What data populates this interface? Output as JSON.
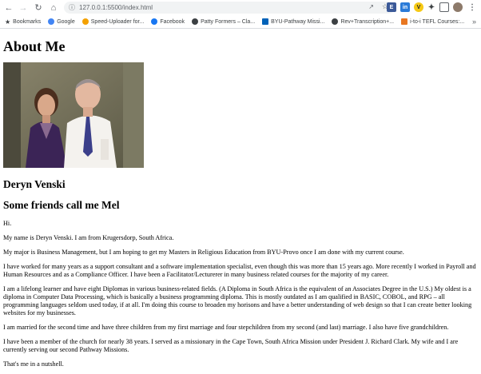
{
  "browser": {
    "url": "127.0.0.1:5500/index.html",
    "bookmarks": [
      {
        "label": "Bookmarks",
        "icon": "star-icon",
        "color": "#3c4043"
      },
      {
        "label": "Google",
        "icon": "google-icon",
        "color": "#4285f4"
      },
      {
        "label": "Speed-Uploader for...",
        "icon": "speed-uploader-icon",
        "color": "#f4a100"
      },
      {
        "label": "Facebook",
        "icon": "facebook-icon",
        "color": "#1877f2"
      },
      {
        "label": "Patty Formers – Cla...",
        "icon": "globe-icon",
        "color": "#3c4043"
      },
      {
        "label": "BYU-Pathway Missi...",
        "icon": "byu-pathway-icon",
        "color": "#0062b8"
      },
      {
        "label": "Rev+Transcription+...",
        "icon": "globe-icon",
        "color": "#3c4043"
      },
      {
        "label": "i-to-i TEFL Courses:...",
        "icon": "tefl-icon",
        "color": "#e87722"
      }
    ]
  },
  "page": {
    "title": "About Me",
    "photo_alt": "Photo of Deryn Venski and husband",
    "name": "Deryn Venski",
    "nickname": "Some friends call me Mel",
    "paragraphs": [
      "Hi.",
      "My name is Deryn Venski. I am from Krugersdorp, South Africa.",
      "My major is Business Management, but I am hoping to get my Masters in Religious Education from BYU-Provo once I am done with my current course.",
      "I have worked for many years as a support consultant and a software implementation specialist, even though this was more than 15 years ago. More recently I worked in Payroll and Human Resources and as a Compliance Officer. I have been a Facilitator/Lecturerer in many business related courses for the majority of my career.",
      "I am a lifelong learner and have eight Diplomas in various business-related fields. (A Diploma in South Africa is the equivalent of an Associates Degree in the U.S.) My oldest is a diploma in Computer Data Processing, which is basically a business programming diploma. This is mostly outdated as I am qualified in BASIC, COBOL, and RPG – all programming languages seldom used today, if at all. I'm doing this course to broaden my horisons and have a better understanding of web design so that I can create better looking websites for my businesses.",
      "I am married for the second time and have three children from my first marriage and four stepchildren from my second (and last) marriage. I also have five grandchildren.",
      "I have been a member of the church for nearly 38 years. I served as a missionary in the Cape Town, South Africa Mission under President J. Richard Clark. My wife and I are currently serving our second Pathway Missions.",
      "That's me in a nutshell."
    ]
  }
}
